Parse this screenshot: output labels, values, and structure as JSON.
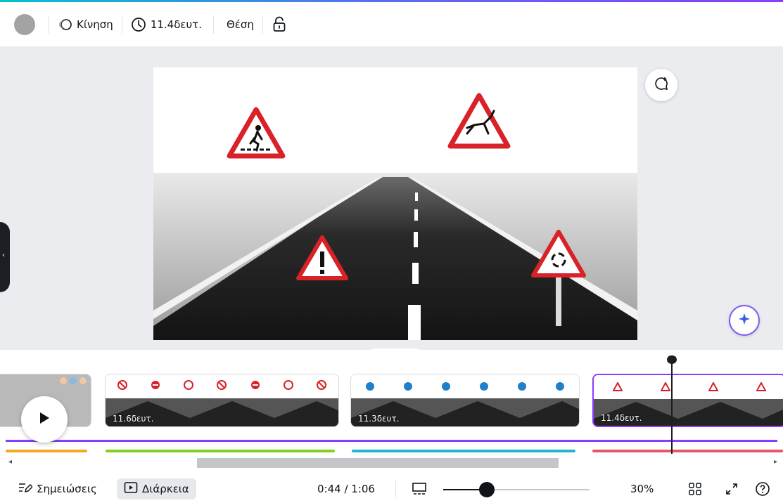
{
  "toolbar": {
    "motion_label": "Κίνηση",
    "duration_label": "11.4δευτ.",
    "position_label": "Θέση"
  },
  "clips": [
    {
      "label": "11.6δευτ."
    },
    {
      "label": "11.3δευτ."
    },
    {
      "label": "11.4δευτ."
    }
  ],
  "bottom": {
    "notes_label": "Σημειώσεις",
    "duration_label": "Διάρκεια",
    "time_readout": "0:44 / 1:06",
    "zoom_label": "30%"
  },
  "zoom_level": 0.3,
  "colors": {
    "accent": "#8b3dff",
    "sign_red": "#d92128",
    "sign_blue": "#1f7fc8",
    "audio_orange": "#f5a623",
    "audio_green": "#7ed321",
    "audio_teal": "#21b5c9",
    "audio_pink": "#e8566b"
  }
}
